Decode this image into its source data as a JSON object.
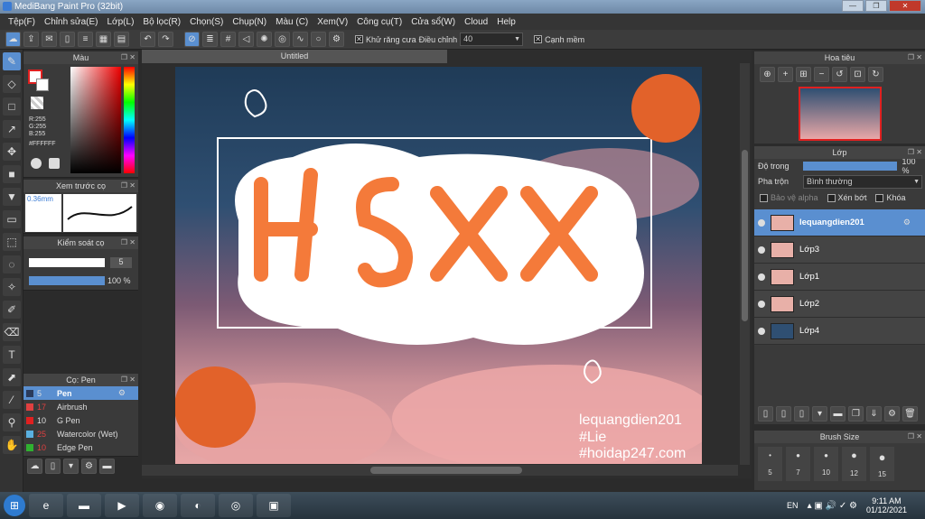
{
  "window": {
    "title": "MediBang Paint Pro (32bit)"
  },
  "menu": [
    "Tệp(F)",
    "Chỉnh sửa(E)",
    "Lớp(L)",
    "Bộ lọc(R)",
    "Chọn(S)",
    "Chụp(N)",
    "Màu (C)",
    "Xem(V)",
    "Công cụ(T)",
    "Cửa sổ(W)",
    "Cloud",
    "Help"
  ],
  "toolbar": {
    "antialias_label": "Khử răng cưa",
    "adjust_label": "Điều chỉnh",
    "adjust_value": "40",
    "smooth_edge_label": "Cạnh mềm"
  },
  "color_panel": {
    "title": "Màu",
    "r": "R:255",
    "g": "G:255",
    "b": "B:255",
    "hex": "#FFFFFF",
    "accent": "#5a8fd0"
  },
  "brush_preview": {
    "title": "Xem trước cọ",
    "size": "0.36mm"
  },
  "brush_control": {
    "title": "Kiểm soát cọ",
    "size_value": "5",
    "opacity_value": "100 %"
  },
  "brush_list": {
    "title": "Cọ: Pen",
    "items": [
      {
        "num": "5",
        "name": "Pen",
        "color": "#5a8fd0"
      },
      {
        "num": "17",
        "name": "Airbrush",
        "color": "#e04040"
      },
      {
        "num": "10",
        "name": "G Pen",
        "color": "#e02020"
      },
      {
        "num": "25",
        "name": "Watercolor (Wet)",
        "color": "#5ab0e0"
      },
      {
        "num": "10",
        "name": "Edge Pen",
        "color": "#30b030"
      }
    ]
  },
  "document": {
    "tab": "Untitled",
    "watermark": [
      "lequangdien201",
      "#Lie",
      "#hoidap247.com"
    ]
  },
  "navigator": {
    "title": "Hoa tiêu"
  },
  "layer_panel": {
    "title": "Lớp",
    "opacity_label": "Độ trong",
    "opacity_value": "100 %",
    "blend_label": "Pha trộn",
    "blend_value": "Bình thường",
    "protect_alpha": "Bảo vệ alpha",
    "clipping": "Xén bớt",
    "lock": "Khóa",
    "layers": [
      "lequangdien201",
      "Lớp3",
      "Lớp1",
      "Lớp2",
      "Lớp4"
    ]
  },
  "brush_size": {
    "title": "Brush Size",
    "sizes": [
      "5",
      "7",
      "10",
      "12",
      "15"
    ]
  },
  "taskbar": {
    "lang": "EN",
    "time": "9:11 AM",
    "date": "01/12/2021"
  }
}
